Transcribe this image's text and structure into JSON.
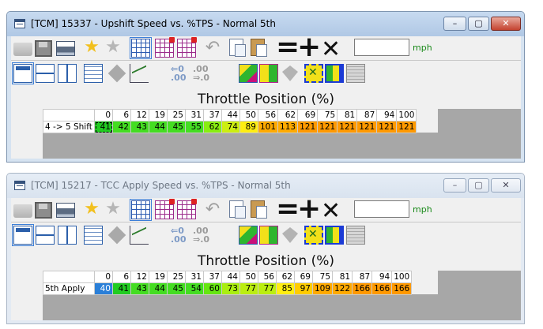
{
  "windows": [
    {
      "title": "[TCM] 15337 - Upshift Speed vs. %TPS - Normal 5th",
      "active": true,
      "unit": "mph",
      "axis_label": "Throttle Position (%)",
      "columns": [
        "0",
        "6",
        "12",
        "19",
        "25",
        "31",
        "37",
        "44",
        "50",
        "56",
        "62",
        "69",
        "75",
        "81",
        "87",
        "94",
        "100"
      ],
      "row_label": "4 -> 5 Shift",
      "values": [
        "41",
        "42",
        "43",
        "44",
        "45",
        "55",
        "62",
        "74",
        "89",
        "101",
        "113",
        "121",
        "121",
        "121",
        "121",
        "121",
        "121"
      ],
      "colors": [
        "#22cc22",
        "#44dd22",
        "#44dd22",
        "#44dd22",
        "#44dd22",
        "#44dd22",
        "#88ee11",
        "#ccee11",
        "#ffee11",
        "#ffaa00",
        "#ffaa00",
        "#ff9900",
        "#ff9900",
        "#ff9900",
        "#ff9900",
        "#ff9900",
        "#ff9900"
      ]
    },
    {
      "title": "[TCM] 15217 - TCC Apply Speed vs. %TPS - Normal 5th",
      "active": false,
      "unit": "mph",
      "axis_label": "Throttle Position (%)",
      "columns": [
        "0",
        "6",
        "12",
        "19",
        "25",
        "31",
        "37",
        "44",
        "50",
        "56",
        "62",
        "69",
        "75",
        "81",
        "87",
        "94",
        "100"
      ],
      "row_label": "5th Apply",
      "values": [
        "40",
        "41",
        "43",
        "44",
        "45",
        "54",
        "60",
        "73",
        "77",
        "77",
        "85",
        "97",
        "109",
        "122",
        "166",
        "166",
        "166"
      ],
      "colors": [
        "#2a7fd8",
        "#22cc22",
        "#44dd22",
        "#44dd22",
        "#44dd22",
        "#44dd22",
        "#66e611",
        "#aaee11",
        "#bbee11",
        "#bbee11",
        "#ffee11",
        "#ffcc00",
        "#ffaa00",
        "#ffaa00",
        "#ff9900",
        "#ff9900",
        "#ff9900"
      ]
    }
  ],
  "window_buttons": {
    "minimize": "–",
    "maximize": "▢",
    "close": "✕"
  },
  "toolbar_symbols": {
    "equals": "=",
    "plus": "+",
    "times": "✕"
  },
  "decimal_labels": {
    "dec_left_top": "⇐0",
    "dec_left_bottom": ".00",
    "dec_right_top": ".00",
    "dec_right_bottom": "⇒.0"
  }
}
